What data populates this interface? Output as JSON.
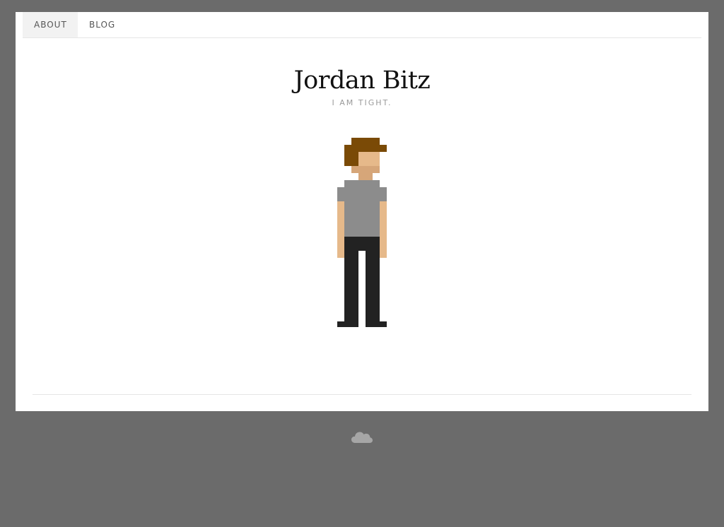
{
  "nav": {
    "items": [
      {
        "label": "ABOUT",
        "active": true
      },
      {
        "label": "BLOG",
        "active": false
      }
    ]
  },
  "header": {
    "title": "Jordan Bitz",
    "tagline": "I AM TIGHT."
  },
  "avatar": {
    "icon": "pixel-person",
    "colors": {
      "hair": "#7a4a06",
      "skin": "#e6b98a",
      "shirt": "#8c8c8c",
      "pants": "#222222",
      "stubble": "#d6a679"
    }
  },
  "footer": {
    "icon": "cloud-icon"
  },
  "theme": {
    "background": "#6b6b6b",
    "card": "#ffffff",
    "cloud": "#a6a6a6"
  }
}
